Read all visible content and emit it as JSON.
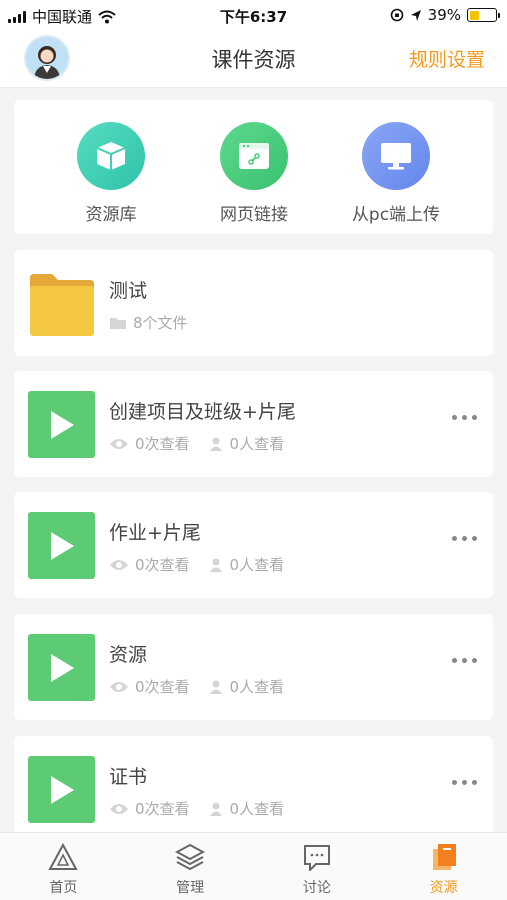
{
  "status_bar": {
    "carrier": "中国联通",
    "time": "下午6:37",
    "battery": "39%",
    "battery_level": 0.39
  },
  "header": {
    "title": "课件资源",
    "rule_settings": "规则设置"
  },
  "quick_actions": [
    {
      "label": "资源库",
      "icon": "box-icon",
      "color": "#3ecfb5"
    },
    {
      "label": "网页链接",
      "icon": "browser-link-icon",
      "color": "#49cc7e"
    },
    {
      "label": "从pc端上传",
      "icon": "monitor-icon",
      "color": "#6d8ef0"
    }
  ],
  "folder": {
    "title": "测试",
    "file_count": "8个文件"
  },
  "resources": [
    {
      "title": "创建项目及班级+片尾",
      "views": "0次查看",
      "viewers": "0人查看"
    },
    {
      "title": "作业+片尾",
      "views": "0次查看",
      "viewers": "0人查看"
    },
    {
      "title": "资源",
      "views": "0次查看",
      "viewers": "0人查看"
    },
    {
      "title": "证书",
      "views": "0次查看",
      "viewers": "0人查看"
    }
  ],
  "tabs": [
    {
      "label": "首页",
      "icon": "home-triangle-icon",
      "active": false
    },
    {
      "label": "管理",
      "icon": "layers-icon",
      "active": false
    },
    {
      "label": "讨论",
      "icon": "chat-icon",
      "active": false
    },
    {
      "label": "资源",
      "icon": "resource-book-icon",
      "active": true
    }
  ],
  "colors": {
    "accent": "#f39a1e",
    "play_thumb": "#5ccb74",
    "folder": "#f5c842"
  }
}
